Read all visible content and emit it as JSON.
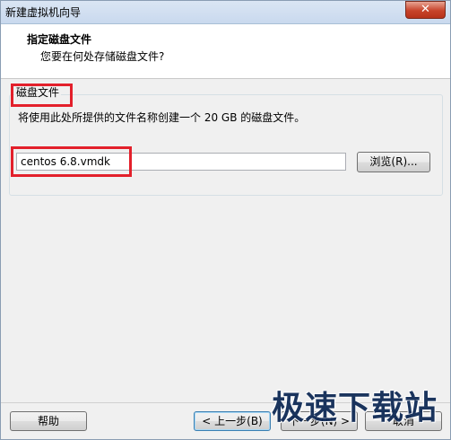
{
  "window": {
    "title": "新建虚拟机向导",
    "close_glyph": "✕"
  },
  "header": {
    "title": "指定磁盘文件",
    "subtitle": "您要在何处存储磁盘文件?"
  },
  "group": {
    "legend": "磁盘文件",
    "description": "将使用此处所提供的文件名称创建一个 20 GB 的磁盘文件。",
    "file_value": "centos 6.8.vmdk",
    "browse_label": "浏览(R)..."
  },
  "footer": {
    "help_label": "帮助",
    "back_label": "< 上一步(B)",
    "next_label": "下一步(N) >",
    "cancel_label": "取消"
  },
  "watermark": "极速下载站",
  "colors": {
    "highlight": "#e3202b",
    "titlebar": "#c9d9ee"
  }
}
